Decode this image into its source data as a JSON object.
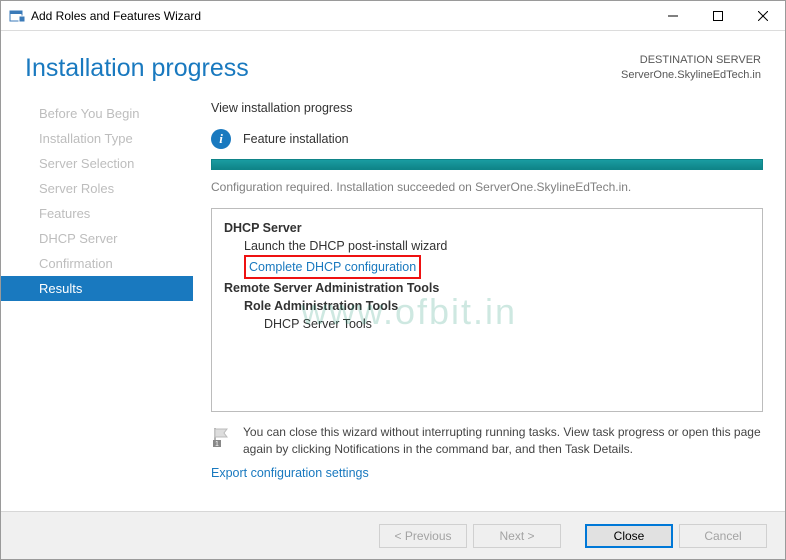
{
  "titlebar": {
    "title": "Add Roles and Features Wizard"
  },
  "header": {
    "title": "Installation progress",
    "dest_label": "DESTINATION SERVER",
    "dest_value": "ServerOne.SkylineEdTech.in"
  },
  "sidebar": {
    "items": [
      {
        "label": "Before You Begin"
      },
      {
        "label": "Installation Type"
      },
      {
        "label": "Server Selection"
      },
      {
        "label": "Server Roles"
      },
      {
        "label": "Features"
      },
      {
        "label": "DHCP Server"
      },
      {
        "label": "Confirmation"
      },
      {
        "label": "Results"
      }
    ],
    "active_index": 7
  },
  "main": {
    "section_title": "View installation progress",
    "feature_label": "Feature installation",
    "status_msg": "Configuration required. Installation succeeded on ServerOne.SkylineEdTech.in.",
    "results": {
      "r0": "DHCP Server",
      "r1": "Launch the DHCP post-install wizard",
      "r2": "Complete DHCP configuration",
      "r3": "Remote Server Administration Tools",
      "r4": "Role Administration Tools",
      "r5": "DHCP Server Tools"
    },
    "hint": "You can close this wizard without interrupting running tasks. View task progress or open this page again by clicking Notifications in the command bar, and then Task Details.",
    "export_link": "Export configuration settings"
  },
  "footer": {
    "previous": "< Previous",
    "next": "Next >",
    "close": "Close",
    "cancel": "Cancel"
  },
  "watermark": "www.ofbit.in"
}
